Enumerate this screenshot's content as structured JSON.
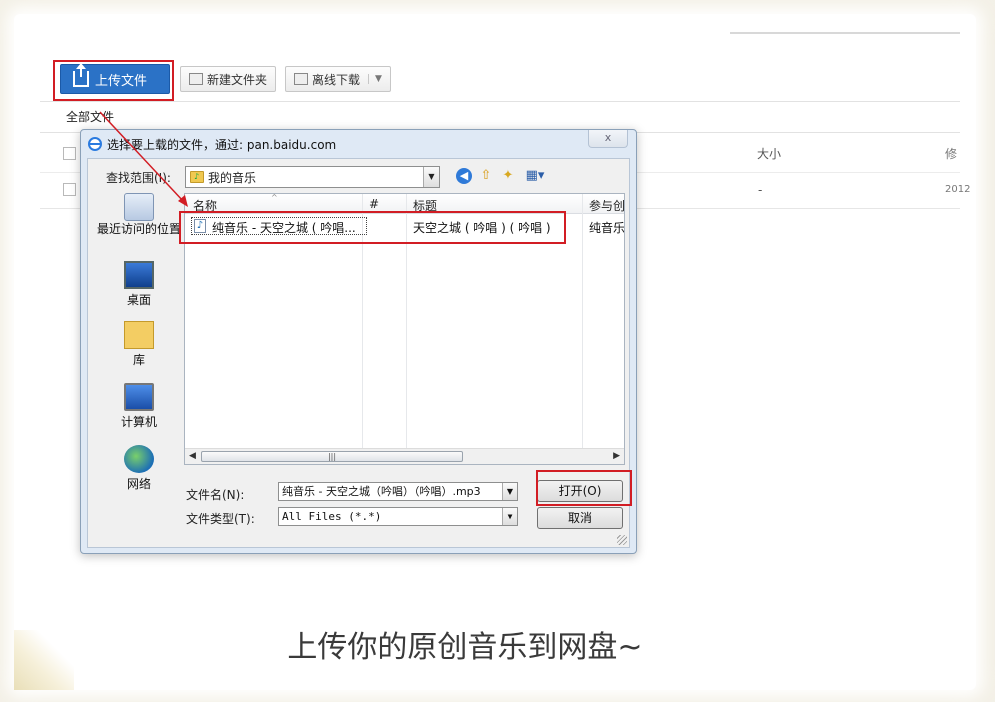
{
  "toolbar": {
    "upload_label": "上传文件",
    "new_folder_label": "新建文件夹",
    "offline_download_label": "离线下载"
  },
  "breadcrumb": "全部文件",
  "list_header": {
    "size": "大小",
    "date": "修"
  },
  "list_row": {
    "size": "-",
    "date": "2012"
  },
  "dialog": {
    "title": "选择要上载的文件，通过: pan.baidu.com",
    "close": "x",
    "look_in_label": "查找范围(I):",
    "look_in_value": "我的音乐",
    "places": [
      {
        "label": "最近访问的位置",
        "icon": "recent-places-icon"
      },
      {
        "label": "桌面",
        "icon": "desktop-icon"
      },
      {
        "label": "库",
        "icon": "libraries-icon"
      },
      {
        "label": "计算机",
        "icon": "computer-icon"
      },
      {
        "label": "网络",
        "icon": "network-icon"
      }
    ],
    "columns": [
      "名称",
      "#",
      "标题",
      "参与创作"
    ],
    "files": [
      {
        "name": "纯音乐 - 天空之城 ( 吟唱...",
        "number": "",
        "title": "天空之城 ( 吟唱 ) ( 吟唱 )",
        "artist": "纯音乐"
      }
    ],
    "file_name_label": "文件名(N):",
    "file_name_value": "纯音乐 - 天空之城（吟唱）（吟唱）.mp3",
    "file_type_label": "文件类型(T):",
    "file_type_value": "All Files (*.*)",
    "open_label": "打开(O)",
    "cancel_label": "取消"
  },
  "caption": "上传你的原创音乐到网盘~",
  "colors": {
    "highlight": "#d21d24",
    "upload_button": "#2b72c6"
  }
}
